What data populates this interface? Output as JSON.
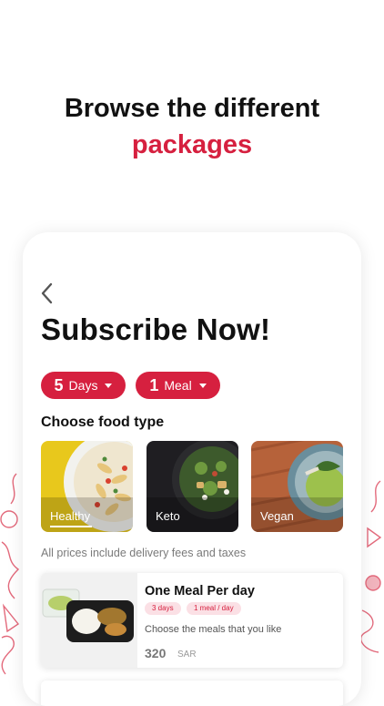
{
  "promo": {
    "title": "Browse the different",
    "accent": "packages",
    "accent_color": "#d6203f"
  },
  "screen": {
    "back_icon": "chevron-left-icon",
    "title": "Subscribe Now!",
    "filters": {
      "days": {
        "number": "5",
        "unit": "Days"
      },
      "meals": {
        "number": "1",
        "unit": "Meal"
      }
    },
    "food_type_title": "Choose food type",
    "food_types": [
      {
        "label": "Healthy",
        "selected": true
      },
      {
        "label": "Keto",
        "selected": false
      },
      {
        "label": "Vegan",
        "selected": false
      }
    ],
    "note": "All prices include delivery fees and taxes",
    "packages": [
      {
        "name": "One Meal Per day",
        "tags": [
          "3 days",
          "1 meal / day"
        ],
        "description": "Choose the meals that you like",
        "price": "320",
        "currency": "SAR"
      }
    ]
  }
}
